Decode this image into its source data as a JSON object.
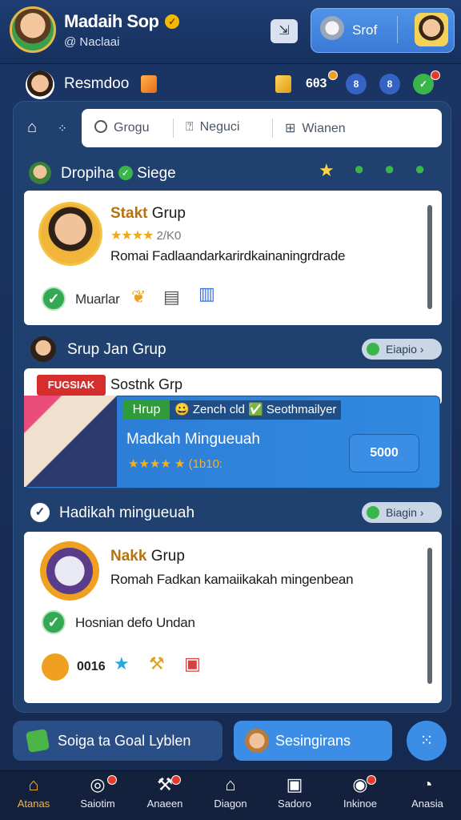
{
  "header": {
    "title": "Madaih Sop",
    "subtitle": "@ Naclaai",
    "share_button": "⇲",
    "profile_label": "Srof"
  },
  "subheader": {
    "label": "Resmdoo",
    "stat_value": "6θ3",
    "btn1": "8",
    "btn2": "8"
  },
  "search": {
    "segments": [
      "Grogu",
      "Neguci",
      "Wianen"
    ]
  },
  "section1": {
    "title": "Dropiha",
    "badge_label": "Siege",
    "card": {
      "title_accent": "Stakt",
      "title": "Grup",
      "stars": "★★★★",
      "rating": "2/K0",
      "description": "Romai Fadlaandarkarirdkainaningrdrade",
      "footer_label": "Muarlar"
    }
  },
  "section2": {
    "title": "Srup Jan Grup",
    "action": "Eiapio",
    "card_title": "Sostnk Grp",
    "ribbon": "FUGSIAK",
    "featured": {
      "tag": "Hrup",
      "chip": "😀 Zench cld ✅ Seothmailyer",
      "title": "Madkah Mingueuah",
      "rating": "★★★★ ★ (1b10:",
      "price_button": "5000"
    }
  },
  "section3": {
    "title": "Hadikah mingueuah",
    "action": "Biagin",
    "card": {
      "title_accent": "Nakk",
      "title": "Grup",
      "description": "Romah Fadkan kamaiikakah mingenbean",
      "status": "Hosnian defo Undan",
      "icon_label": "0016"
    }
  },
  "actions": {
    "left": "Soiga ta Goal Lyblen",
    "right": "Sesingirans"
  },
  "nav": {
    "items": [
      {
        "label": "Atanas",
        "icon": "home-icon"
      },
      {
        "label": "Saiotim",
        "icon": "target-icon"
      },
      {
        "label": "Anaeen",
        "icon": "tools-icon"
      },
      {
        "label": "Diagon",
        "icon": "house-icon"
      },
      {
        "label": "Sadoro",
        "icon": "box-icon"
      },
      {
        "label": "Inkinoe",
        "icon": "record-icon"
      },
      {
        "label": "Anasia",
        "icon": "chat-icon"
      }
    ]
  },
  "colors": {
    "background": "#1b3566",
    "accent_orange": "#ffb23a",
    "accent_blue": "#3b8de6",
    "success": "#34a853"
  }
}
